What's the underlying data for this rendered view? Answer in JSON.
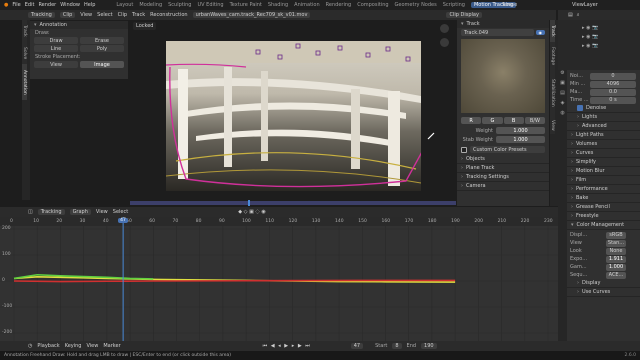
{
  "topbar": {
    "menus": [
      "File",
      "Edit",
      "Render",
      "Window",
      "Help"
    ],
    "workspaces": [
      "Layout",
      "Modeling",
      "Sculpting",
      "UV Editing",
      "Texture Paint",
      "Shading",
      "Animation",
      "Rendering",
      "Compositing",
      "Geometry Nodes",
      "Scripting",
      "Motion Tracking"
    ],
    "active_workspace": "Motion Tracking",
    "scene": "Scene",
    "view_layer": "ViewLayer"
  },
  "clip_header": {
    "mode": "Tracking",
    "view_mode": "Clip",
    "menus": [
      "View",
      "Select",
      "Clip",
      "Track",
      "Reconstruction"
    ],
    "filename": "urbanWaves_cam.track_Rec709_sk_v01.mov",
    "display": "Clip Display",
    "locked": "Locked"
  },
  "annotation_panel": {
    "title": "Annotation",
    "draw_label": "Draw:",
    "tools": [
      "Draw",
      "Erase",
      "Line",
      "Poly"
    ],
    "placement_label": "Stroke Placement:",
    "placement": [
      "View",
      "Image"
    ]
  },
  "left_tabs": [
    "Track",
    "Solve",
    "Annotation"
  ],
  "track_panel": {
    "title": "Track",
    "name": "Track.049",
    "channels": [
      "R",
      "G",
      "B",
      "B/W"
    ],
    "weight_label": "Weight",
    "weight_value": "1.000",
    "stab_label": "Stab Weight",
    "stab_value": "1.000",
    "preset": "Custom Color Presets",
    "sections": [
      "Objects",
      "Plane Track",
      "Tracking Settings",
      "Camera"
    ]
  },
  "right_tabs": [
    "Track",
    "Footage",
    "Stabilization",
    "View"
  ],
  "properties": {
    "rows": [
      {
        "label": "Noi...",
        "value": "0"
      },
      {
        "label": "Min ...",
        "value": "4096"
      },
      {
        "label": "Ma...",
        "value": "0.0"
      },
      {
        "label": "Time ...",
        "value": "0 s"
      }
    ],
    "denoise": "Denoise",
    "sections": [
      "Lights",
      "Advanced",
      "Light Paths",
      "Volumes",
      "Curves",
      "Simplify",
      "Motion Blur",
      "Film",
      "Performance",
      "Bake",
      "Grease Pencil",
      "Freestyle",
      "Color Management"
    ],
    "color": [
      {
        "label": "Displ...",
        "value": "sRGB"
      },
      {
        "label": "View",
        "value": "Stan..."
      },
      {
        "label": "Look",
        "value": "None"
      },
      {
        "label": "Expo...",
        "value": "1.911"
      },
      {
        "label": "Gam...",
        "value": "1.000"
      },
      {
        "label": "Sequ...",
        "value": "ACE..."
      }
    ],
    "bottom_sections": [
      "Display",
      "Use Curves"
    ]
  },
  "graph": {
    "header_mode": "Tracking",
    "header_view": "Graph",
    "menus": [
      "View",
      "Select"
    ],
    "x_ticks": [
      "0",
      "10",
      "20",
      "30",
      "40",
      "50",
      "60",
      "70",
      "80",
      "90",
      "100",
      "110",
      "120",
      "130",
      "140",
      "150",
      "160",
      "170",
      "180",
      "190",
      "200",
      "210",
      "220",
      "230"
    ],
    "y_ticks": [
      "200",
      "100",
      "0",
      "-100",
      "-200"
    ],
    "current_frame": "47",
    "chart_data": {
      "type": "line",
      "x_range": [
        0,
        230
      ],
      "y_range": [
        -200,
        200
      ],
      "series": [
        {
          "color": "#e0e040",
          "values": [
            [
              0,
              10
            ],
            [
              10,
              16
            ],
            [
              20,
              14
            ],
            [
              30,
              12
            ],
            [
              40,
              10
            ],
            [
              60,
              6
            ],
            [
              80,
              4
            ],
            [
              100,
              2
            ],
            [
              120,
              0
            ],
            [
              140,
              -2
            ],
            [
              160,
              -3
            ],
            [
              190,
              -4
            ]
          ]
        },
        {
          "color": "#60d040",
          "values": [
            [
              0,
              10
            ],
            [
              10,
              24
            ],
            [
              20,
              20
            ],
            [
              30,
              17
            ],
            [
              40,
              14
            ],
            [
              50,
              10
            ],
            [
              60,
              8
            ]
          ]
        },
        {
          "color": "#d03030",
          "values": [
            [
              0,
              0
            ],
            [
              20,
              -2
            ],
            [
              40,
              -1
            ],
            [
              60,
              0
            ],
            [
              100,
              1
            ],
            [
              150,
              2
            ],
            [
              190,
              2
            ]
          ]
        }
      ]
    }
  },
  "timeline": {
    "menus": [
      "Playback",
      "Keying",
      "View",
      "Marker"
    ],
    "frame": "47",
    "start_label": "Start",
    "start": "8",
    "end_label": "End",
    "end": "190"
  },
  "status": {
    "text": "Annotation Freehand Draw: Hold and drag LMB to draw | ESC/Enter to end (or click outside this area)",
    "version": "2.6.0"
  }
}
